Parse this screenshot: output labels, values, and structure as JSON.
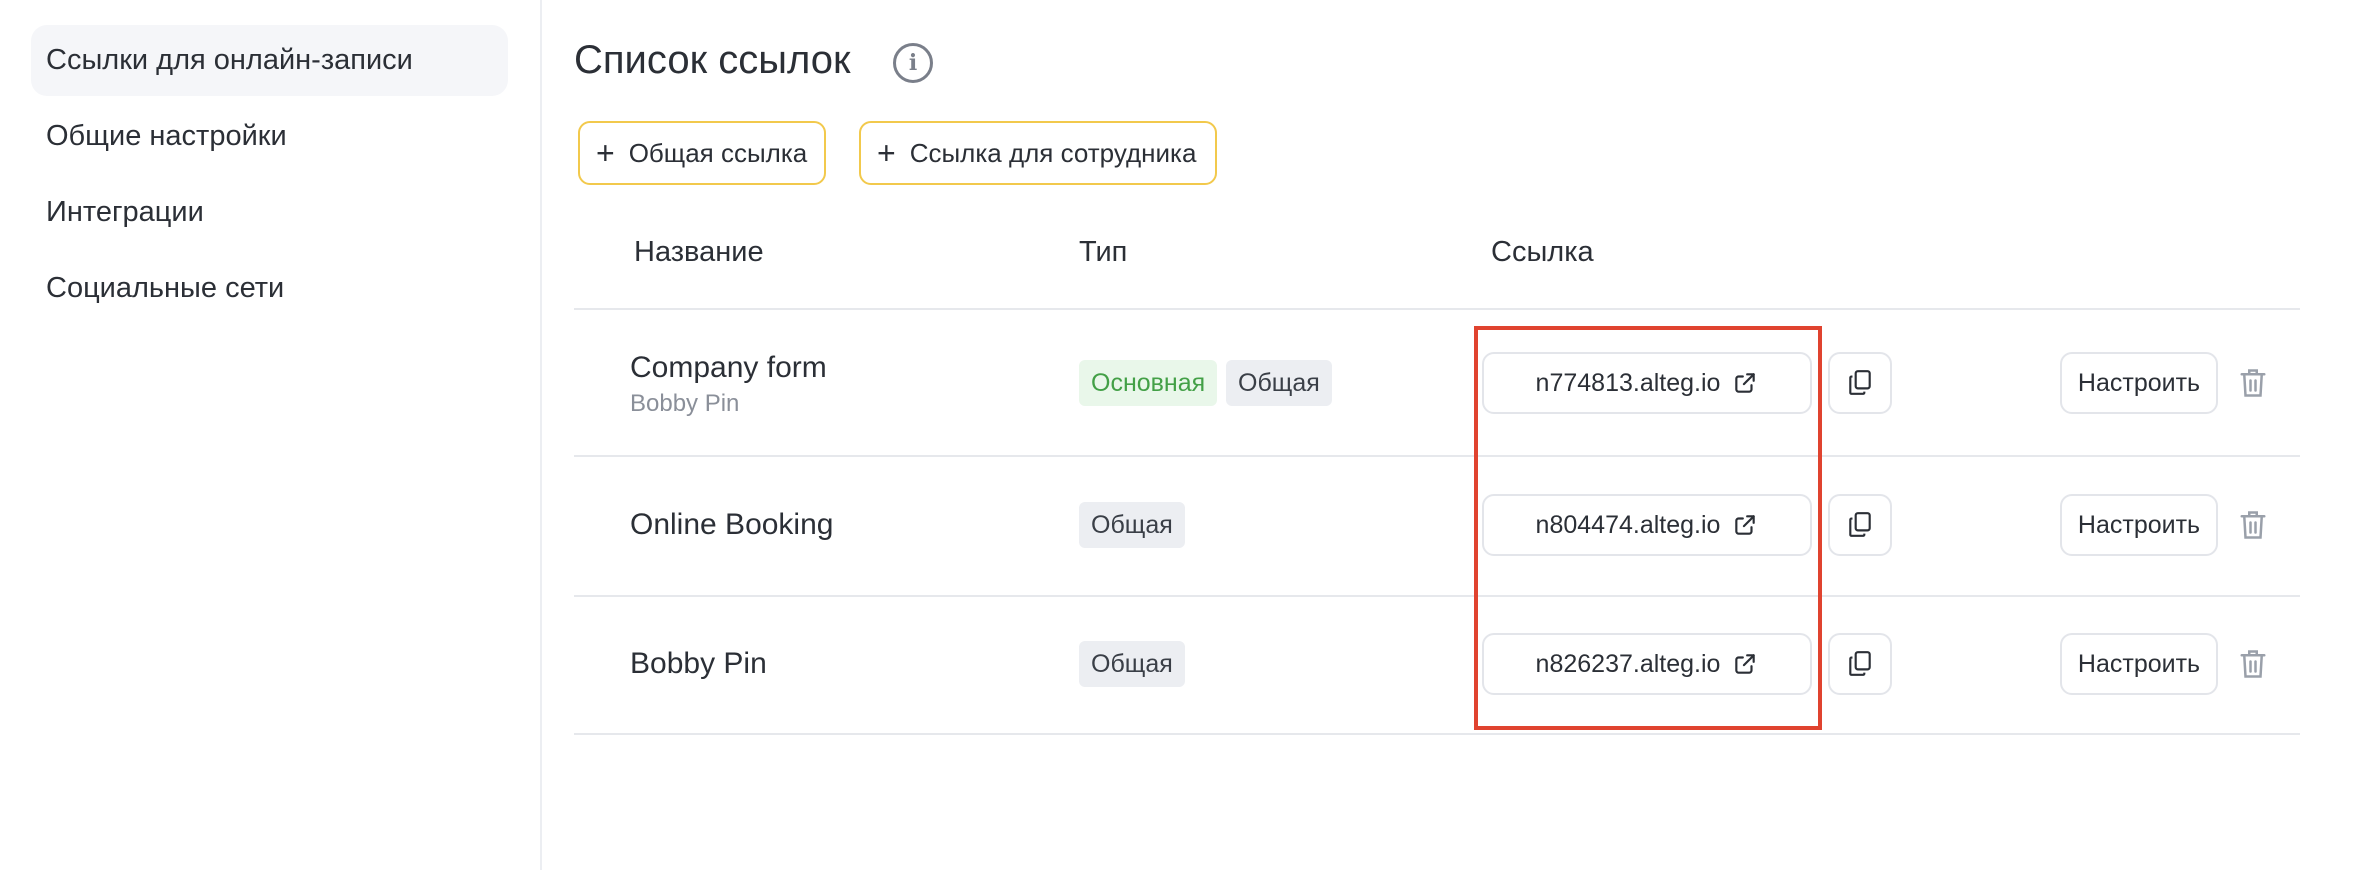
{
  "sidebar": {
    "items": [
      {
        "label": "Ссылки для онлайн-записи",
        "active": true
      },
      {
        "label": "Общие настройки"
      },
      {
        "label": "Интеграции"
      },
      {
        "label": "Социальные сети"
      }
    ]
  },
  "main": {
    "title": "Список ссылок",
    "buttons": {
      "add_common": "Общая ссылка",
      "add_staff": "Ссылка для сотрудника"
    },
    "table": {
      "headers": {
        "name": "Название",
        "type": "Тип",
        "link": "Ссылка"
      },
      "rows": [
        {
          "name": "Company form",
          "subtitle": "Bobby Pin",
          "badges": [
            "Основная",
            "Общая"
          ],
          "link": "n774813.alteg.io",
          "configure": "Настроить"
        },
        {
          "name": "Online Booking",
          "badges": [
            "Общая"
          ],
          "link": "n804474.alteg.io",
          "configure": "Настроить"
        },
        {
          "name": "Bobby Pin",
          "badges": [
            "Общая"
          ],
          "link": "n826237.alteg.io",
          "configure": "Настроить"
        }
      ]
    }
  },
  "colors": {
    "accent_border": "#f2c94c",
    "highlight": "#e0432f",
    "badge_main_text": "#43a047",
    "badge_main_bg": "#e9f7ea"
  },
  "icons": {
    "info": "info-icon",
    "plus": "plus-icon",
    "external": "external-link-icon",
    "copy": "copy-icon",
    "delete": "trash-icon"
  }
}
